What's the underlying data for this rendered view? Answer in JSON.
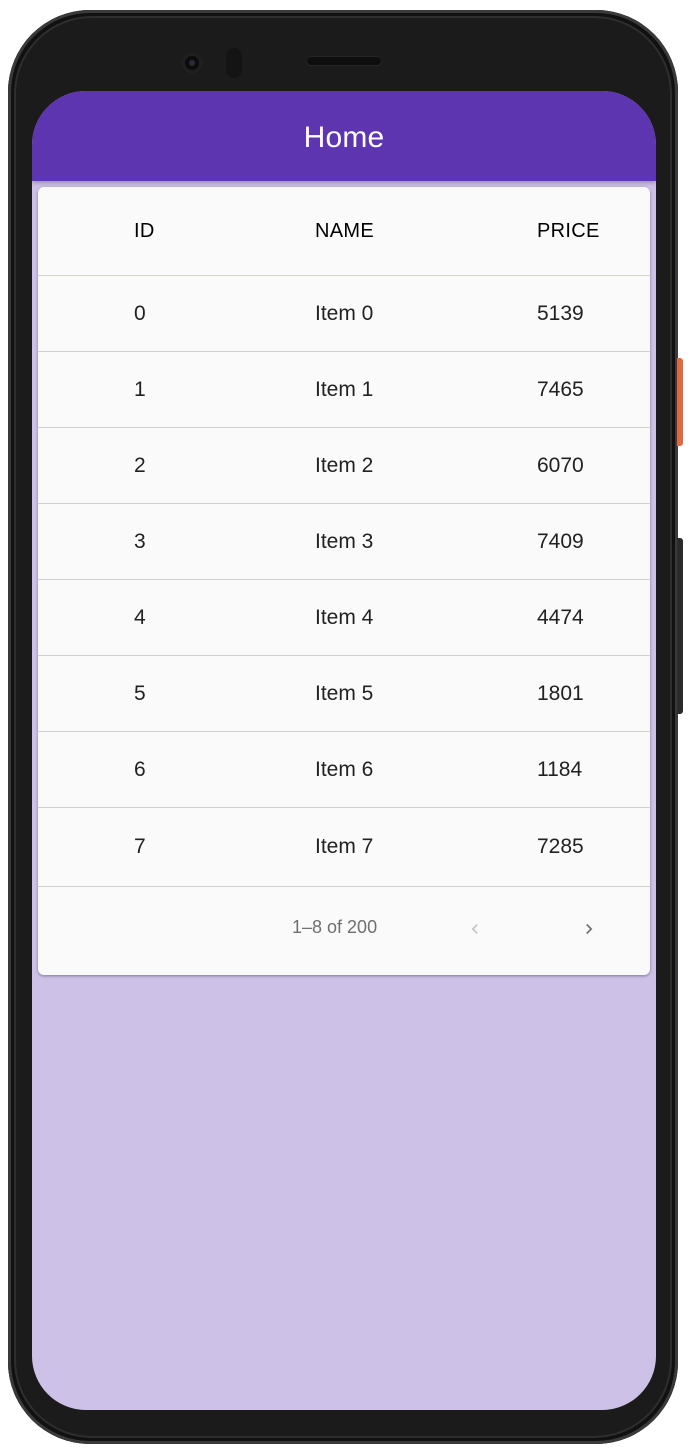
{
  "app_bar": {
    "title": "Home"
  },
  "table": {
    "columns": [
      "ID",
      "NAME",
      "PRICE"
    ],
    "rows": [
      {
        "id": "0",
        "name": "Item 0",
        "price": "5139"
      },
      {
        "id": "1",
        "name": "Item 1",
        "price": "7465"
      },
      {
        "id": "2",
        "name": "Item 2",
        "price": "6070"
      },
      {
        "id": "3",
        "name": "Item 3",
        "price": "7409"
      },
      {
        "id": "4",
        "name": "Item 4",
        "price": "4474"
      },
      {
        "id": "5",
        "name": "Item 5",
        "price": "1801"
      },
      {
        "id": "6",
        "name": "Item 6",
        "price": "1184"
      },
      {
        "id": "7",
        "name": "Item 7",
        "price": "7285"
      }
    ]
  },
  "pagination": {
    "range_text": "1–8 of 200",
    "prev_icon": "chevron-left-icon",
    "next_icon": "chevron-right-icon",
    "prev_enabled": false,
    "next_enabled": true
  },
  "colors": {
    "app_bar": "#5e35b1",
    "background": "#cdc1e8",
    "card": "#fafafa"
  }
}
